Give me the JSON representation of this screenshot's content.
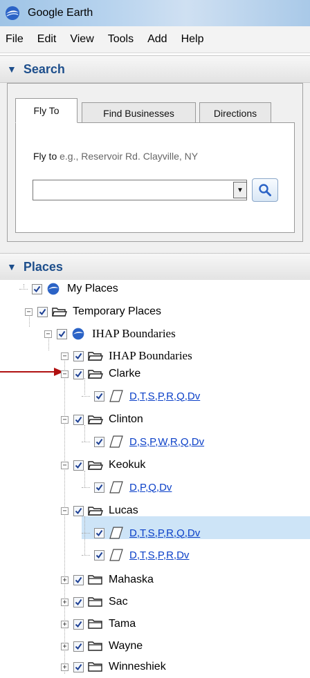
{
  "window": {
    "title": "Google Earth"
  },
  "menu": [
    "File",
    "Edit",
    "View",
    "Tools",
    "Add",
    "Help"
  ],
  "search": {
    "header": "Search",
    "tabs": [
      "Fly To",
      "Find Businesses",
      "Directions"
    ],
    "flyto_label": "Fly to",
    "flyto_hint": "e.g., Reservoir Rd. Clayville, NY",
    "input_value": ""
  },
  "places": {
    "header": "Places",
    "items": [
      {
        "label": "My Places"
      },
      {
        "label": "Temporary Places"
      },
      {
        "label": "IHAP Boundaries"
      },
      {
        "label": "IHAP Boundaries"
      },
      {
        "label": "Clarke"
      },
      {
        "label": "D,T,S,P,R,Q,Dv"
      },
      {
        "label": "Clinton"
      },
      {
        "label": "D,S,P,W,R,Q,Dv"
      },
      {
        "label": "Keokuk"
      },
      {
        "label": "D,P,Q,Dv"
      },
      {
        "label": "Lucas"
      },
      {
        "label": "D,T,S,P,R,Q,Dv"
      },
      {
        "label": "D,T,S,P,R,Dv"
      },
      {
        "label": "Mahaska"
      },
      {
        "label": "Sac"
      },
      {
        "label": "Tama"
      },
      {
        "label": "Wayne"
      },
      {
        "label": "Winneshiek"
      }
    ]
  },
  "colors": {
    "header_text": "#1e4f8c",
    "link": "#0b40c8",
    "selection": "#cde4f7",
    "arrow": "#b01010"
  },
  "icons": {
    "app": "google-earth-globe-icon",
    "search": "magnifier-icon",
    "open_folder": "open-folder-icon",
    "closed_folder": "closed-folder-icon",
    "polygon": "polygon-icon",
    "checkbox": "checked-checkbox-icon"
  }
}
